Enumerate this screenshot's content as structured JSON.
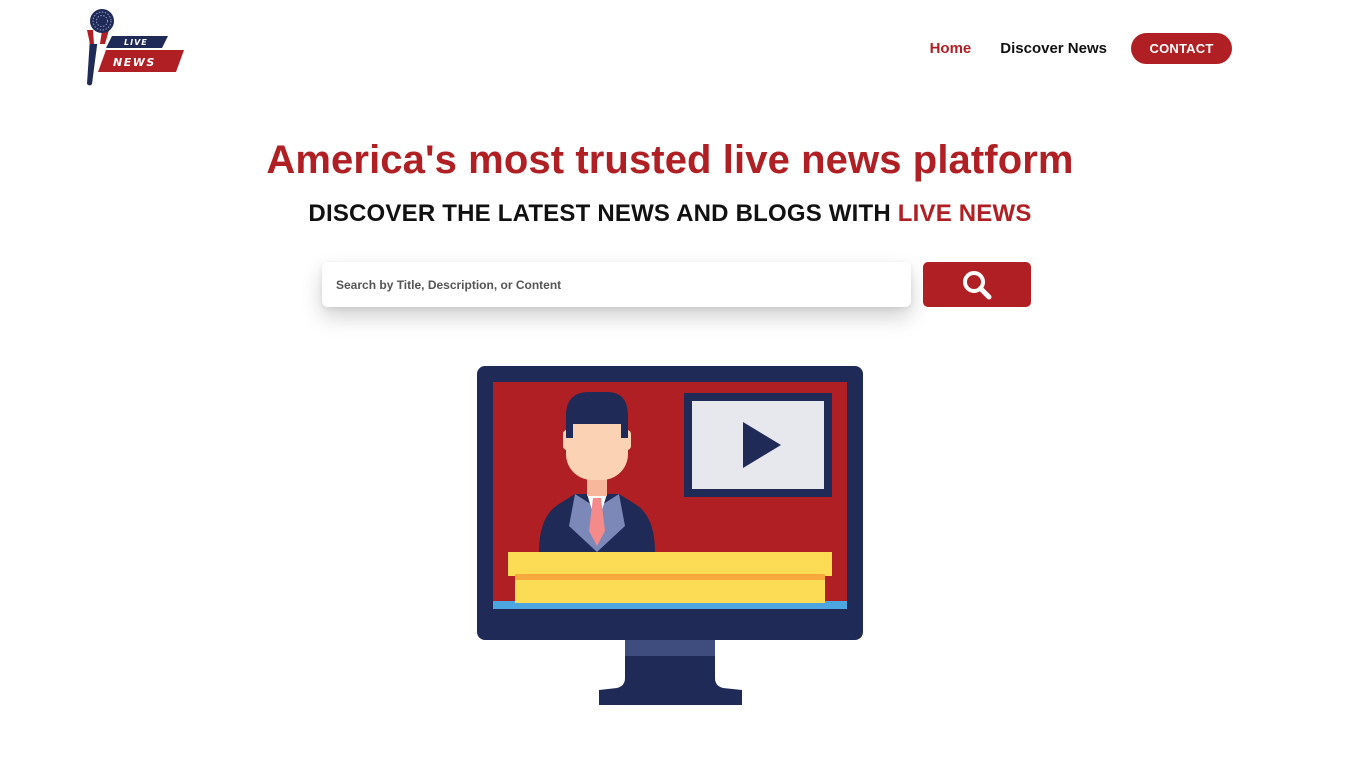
{
  "brand": {
    "logo_line1": "LIVE",
    "logo_line2": "NEWS"
  },
  "nav": {
    "items": [
      {
        "label": "Home",
        "active": true
      },
      {
        "label": "Discover News",
        "active": false
      }
    ],
    "contact_label": "CONTACT"
  },
  "hero": {
    "title": "America's most trusted live news platform",
    "subtitle_main": "DISCOVER THE LATEST NEWS AND BLOGS WITH ",
    "subtitle_accent": "LIVE NEWS"
  },
  "search": {
    "placeholder": "Search by Title, Description, or Content",
    "value": "",
    "button_icon": "search-icon"
  },
  "illustration": {
    "icons": [
      "news-anchor-illustration",
      "monitor-icon",
      "play-icon"
    ]
  },
  "colors": {
    "brand_red": "#b01f24",
    "navy": "#1f2a56",
    "desk_yellow": "#fddc55"
  }
}
